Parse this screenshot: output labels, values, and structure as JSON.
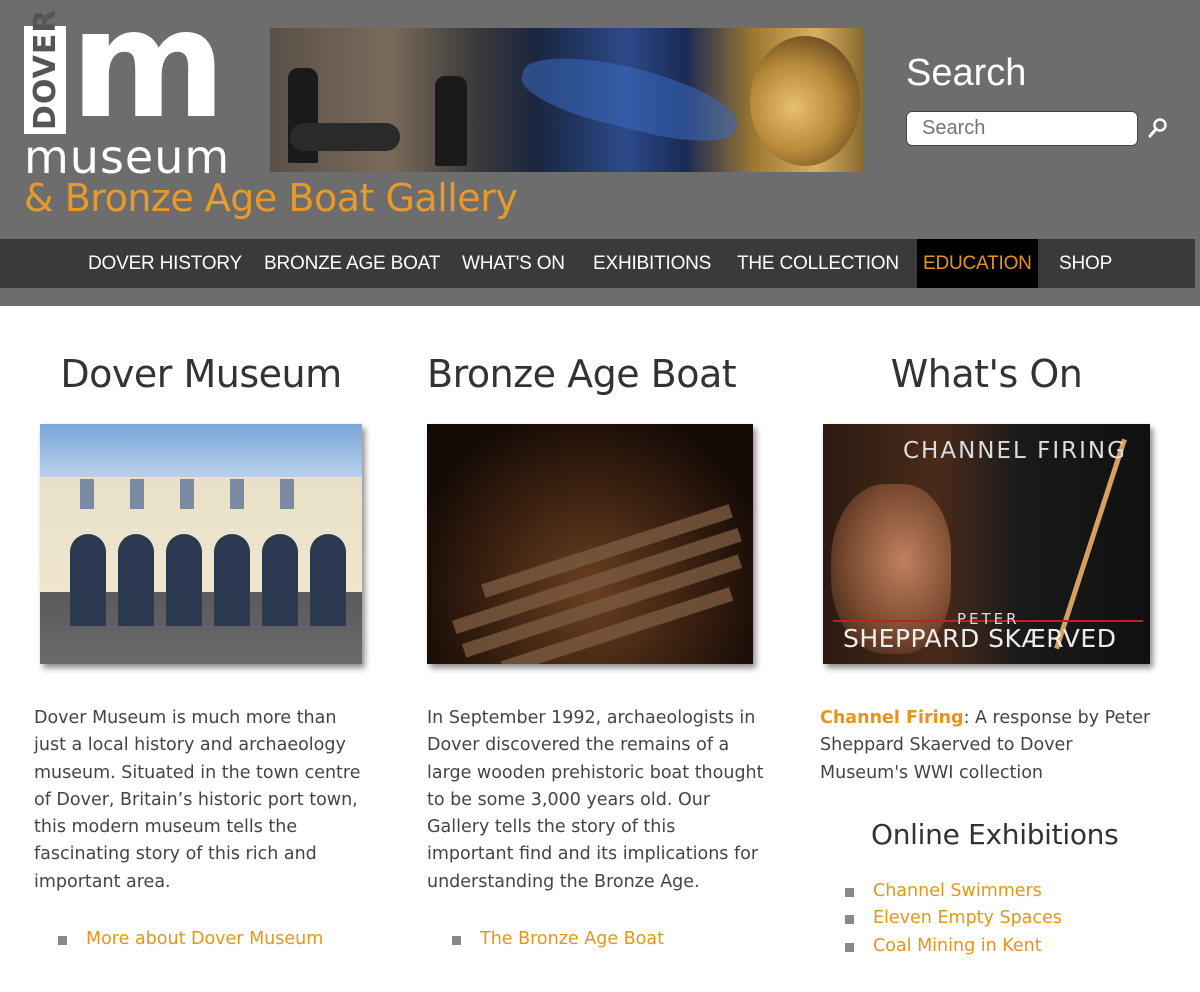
{
  "header": {
    "logo": {
      "dover": "DOVER",
      "m": "m",
      "museum": "museum",
      "gallery": "& Bronze Age Boat Gallery"
    },
    "search": {
      "title": "Search",
      "placeholder": "Search"
    }
  },
  "nav": {
    "items": [
      {
        "label": "DOVER HISTORY"
      },
      {
        "label": "BRONZE AGE BOAT"
      },
      {
        "label": "WHAT'S ON"
      },
      {
        "label": "EXHIBITIONS"
      },
      {
        "label": "THE COLLECTION"
      },
      {
        "label": "EDUCATION",
        "active": true
      },
      {
        "label": "SHOP"
      }
    ]
  },
  "colors": {
    "header_bg": "#6d6d6d",
    "nav_bg": "#3a3a3a",
    "accent": "#e8941c"
  },
  "columns": {
    "museum": {
      "title": "Dover Museum",
      "text": "Dover Museum is much more than just a local history and archaeology museum. Situated in the town centre of Dover, Britain’s historic port town, this modern museum tells the fascinating story of this rich and important area.",
      "link": "More about Dover Museum"
    },
    "boat": {
      "title": "Bronze Age Boat",
      "text": "In September 1992, archaeologists in Dover discovered the remains of a large wooden prehistoric boat thought to be some 3,000 years old. Our Gallery tells the story of this important find and its implications for understanding the Bronze Age.",
      "link": "The Bronze Age Boat"
    },
    "whatson": {
      "title": "What's On",
      "image_text": {
        "channel_firing": "CHANNEL FIRING",
        "peter": "PETER",
        "sheppard": "SHEPPARD SKÆRVED"
      },
      "event_link": "Channel Firing",
      "event_text": ": A response by Peter Sheppard Skaerved  to Dover Museum's WWI collection",
      "online_title": "Online Exhibitions",
      "online_links": [
        "Channel Swimmers",
        "Eleven Empty Spaces",
        "Coal Mining in Kent"
      ]
    }
  }
}
